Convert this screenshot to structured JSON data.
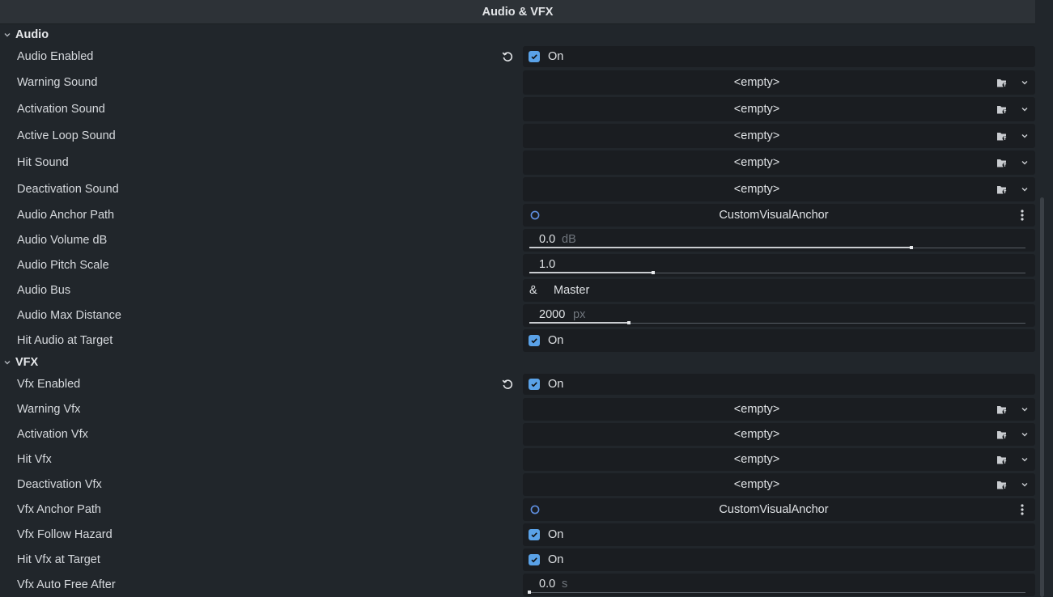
{
  "header": {
    "title": "Audio & VFX"
  },
  "sections": {
    "audio": "Audio",
    "vfx": "VFX"
  },
  "common": {
    "on": "On",
    "empty": "<empty>"
  },
  "audio": {
    "audio_enabled": {
      "label": "Audio Enabled",
      "value": "On"
    },
    "warning_sound": {
      "label": "Warning Sound",
      "value": "<empty>"
    },
    "activation_sound": {
      "label": "Activation Sound",
      "value": "<empty>"
    },
    "active_loop_sound": {
      "label": "Active Loop Sound",
      "value": "<empty>"
    },
    "hit_sound": {
      "label": "Hit Sound",
      "value": "<empty>"
    },
    "deactivation_sound": {
      "label": "Deactivation Sound",
      "value": "<empty>"
    },
    "audio_anchor_path": {
      "label": "Audio Anchor Path",
      "value": "CustomVisualAnchor"
    },
    "audio_volume_db": {
      "label": "Audio Volume dB",
      "value": "0.0",
      "unit": "dB",
      "fraction": 0.77
    },
    "audio_pitch_scale": {
      "label": "Audio Pitch Scale",
      "value": "1.0",
      "unit": "",
      "fraction": 0.25
    },
    "audio_bus": {
      "label": "Audio Bus",
      "prefix": "&",
      "value": "Master"
    },
    "audio_max_distance": {
      "label": "Audio Max Distance",
      "value": "2000",
      "unit": "px",
      "fraction": 0.2
    },
    "hit_audio_at_target": {
      "label": "Hit Audio at Target",
      "value": "On"
    }
  },
  "vfx": {
    "vfx_enabled": {
      "label": "Vfx Enabled",
      "value": "On"
    },
    "warning_vfx": {
      "label": "Warning Vfx",
      "value": "<empty>"
    },
    "activation_vfx": {
      "label": "Activation Vfx",
      "value": "<empty>"
    },
    "hit_vfx": {
      "label": "Hit Vfx",
      "value": "<empty>"
    },
    "deactivation_vfx": {
      "label": "Deactivation Vfx",
      "value": "<empty>"
    },
    "vfx_anchor_path": {
      "label": "Vfx Anchor Path",
      "value": "CustomVisualAnchor"
    },
    "vfx_follow_hazard": {
      "label": "Vfx Follow Hazard",
      "value": "On"
    },
    "hit_vfx_at_target": {
      "label": "Hit Vfx at Target",
      "value": "On"
    },
    "vfx_auto_free_after": {
      "label": "Vfx Auto Free After",
      "value": "0.0",
      "unit": "s",
      "fraction": 0.0
    }
  },
  "colors": {
    "accent": "#5aa2e8",
    "node_icon": "#5f8fe0",
    "panel_bg": "#21262b",
    "field_bg": "#1a1d21"
  }
}
